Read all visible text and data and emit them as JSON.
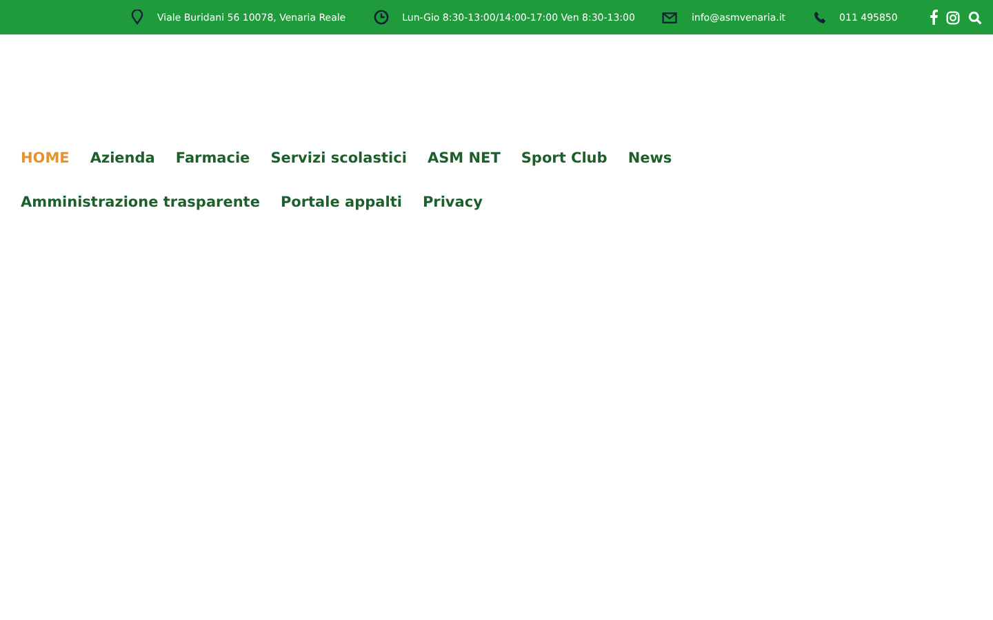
{
  "top_bar": {
    "contacts": [
      {
        "kind": "address",
        "text": "Viale Buridani 56 10078, Venaria Reale"
      },
      {
        "kind": "hours",
        "text": "Lun-Gio 8:30-13:00/14:00-17:00 Ven 8:30-13:00"
      },
      {
        "kind": "email",
        "text": "info@asmvenaria.it"
      },
      {
        "kind": "phone",
        "text": "011 495850"
      }
    ],
    "social": [
      {
        "kind": "facebook"
      },
      {
        "kind": "instagram"
      },
      {
        "kind": "search"
      }
    ]
  },
  "menu": [
    {
      "label": "HOME",
      "selected": true
    },
    {
      "label": "Azienda",
      "selected": false
    },
    {
      "label": "Farmacie",
      "selected": false
    },
    {
      "label": "Servizi scolastici",
      "selected": false
    },
    {
      "label": "ASM NET",
      "selected": false
    },
    {
      "label": "Sport Club",
      "selected": false
    },
    {
      "label": "News",
      "selected": false
    },
    {
      "label": "Amministrazione trasparente",
      "selected": false
    },
    {
      "label": "Portale appalti",
      "selected": false
    },
    {
      "label": "Privacy",
      "selected": false
    }
  ]
}
